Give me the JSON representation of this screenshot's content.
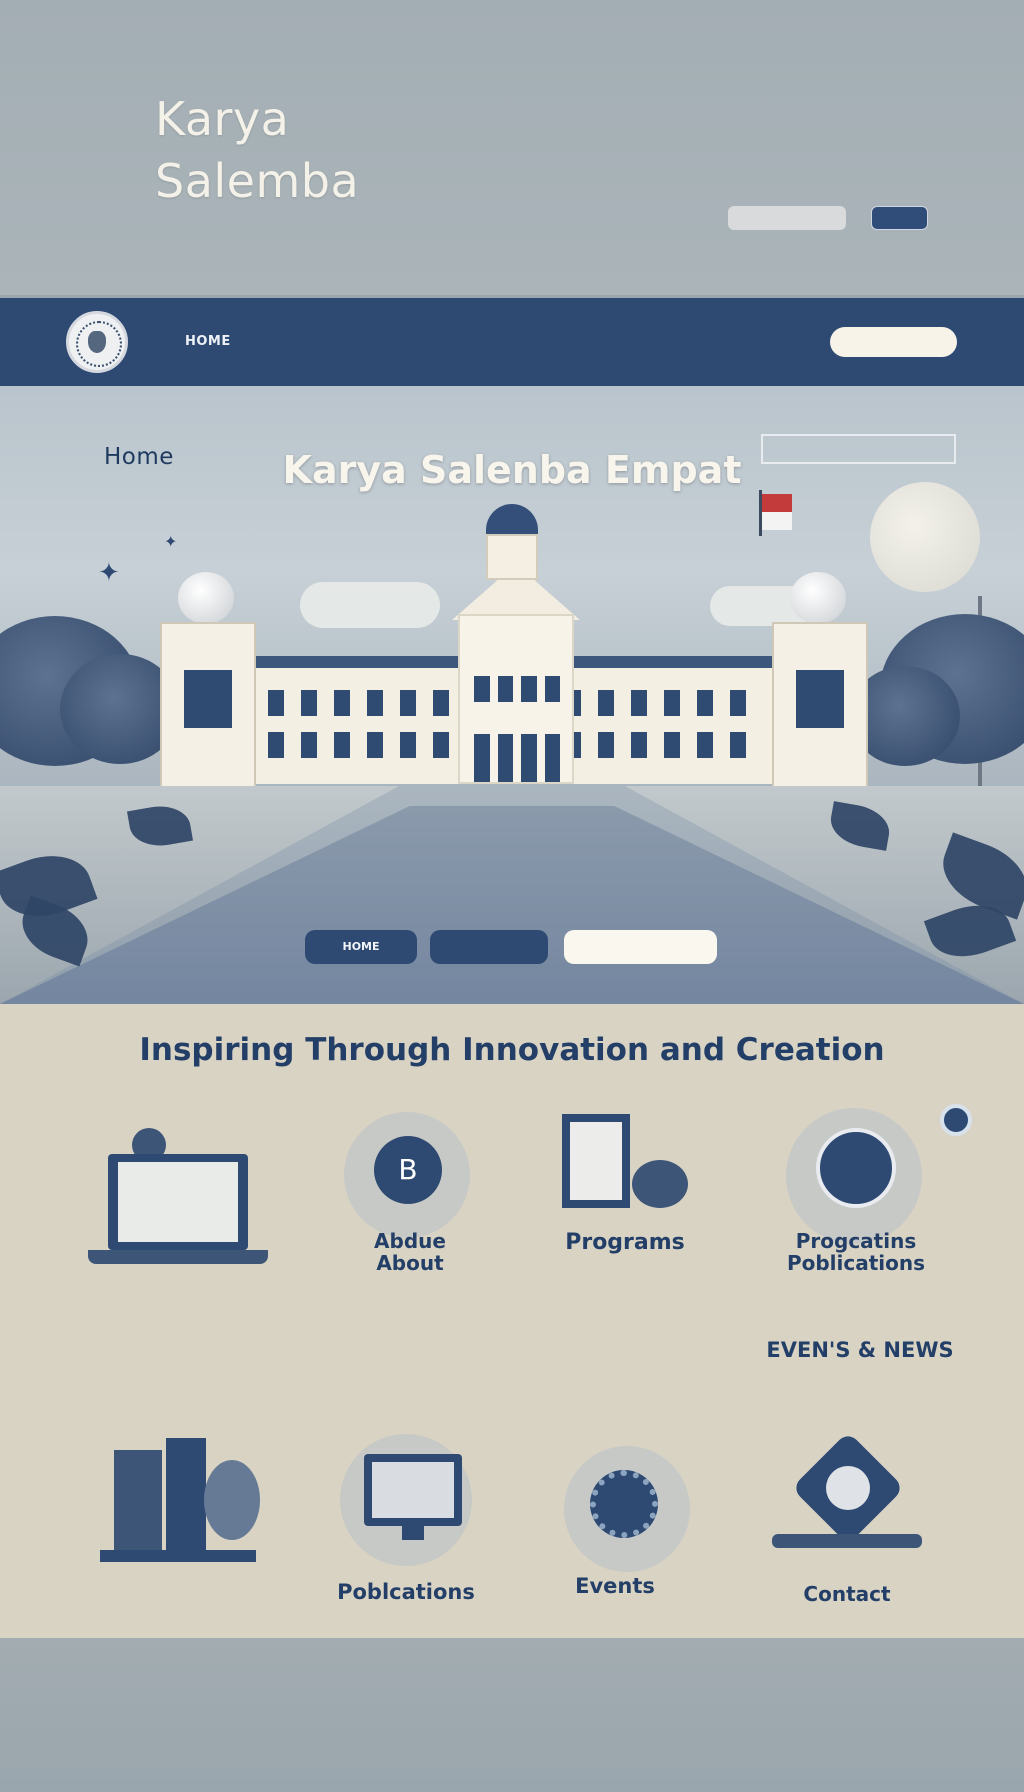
{
  "header": {
    "brand_line1": "Karya",
    "brand_line2": "Salemba",
    "mini_button_left": "",
    "mini_button_right": ""
  },
  "nav": {
    "items": [
      "HOME",
      "",
      "",
      "",
      "",
      ""
    ],
    "cta_label": ""
  },
  "hero": {
    "home_label": "Home",
    "title": "Karya Salenba Empat",
    "badge": "",
    "buttons": [
      "HOME",
      "",
      ""
    ]
  },
  "content": {
    "tagline": "Inspiring Through Innovation and Creation",
    "cards_row1": [
      {
        "title": "",
        "badge": "B"
      },
      {
        "title": "Abdue\nAbout"
      },
      {
        "title": "Programs"
      },
      {
        "title": "Progcatins\nPoblications"
      }
    ],
    "events_news": "EVEN'S & NEWS",
    "cards_row2": [
      {
        "title": ""
      },
      {
        "title": "Poblcations"
      },
      {
        "title": "Events"
      },
      {
        "title": "Contact"
      }
    ]
  },
  "colors": {
    "navy": "#2e4a73",
    "cream": "#f7f3e8",
    "sand": "#d9d3c4"
  }
}
